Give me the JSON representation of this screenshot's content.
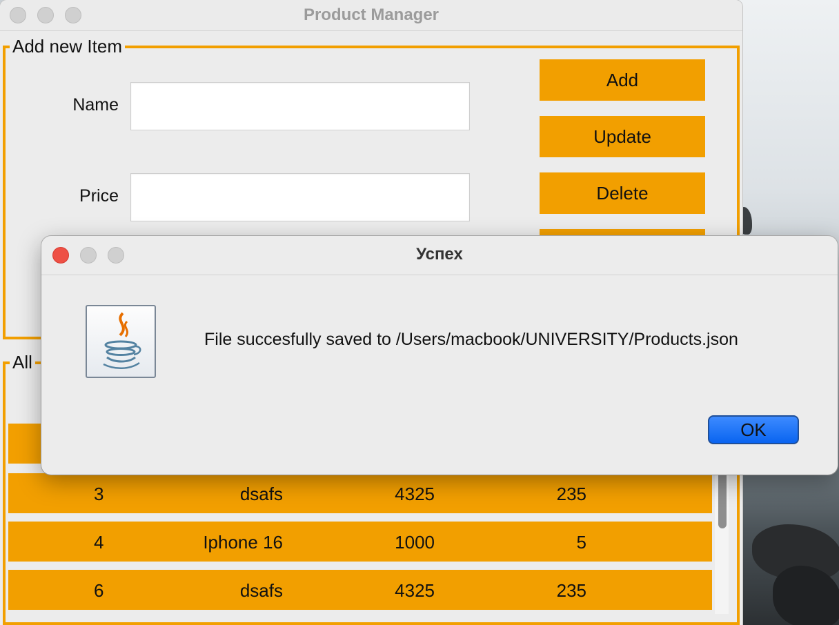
{
  "main_window": {
    "title": "Product Manager",
    "form_panel": {
      "legend": "Add new Item",
      "name_label": "Name",
      "name_value": "",
      "price_label": "Price",
      "price_value": ""
    },
    "buttons": {
      "add": "Add",
      "update": "Update",
      "delete": "Delete"
    },
    "list_panel": {
      "legend": "All",
      "rows": [
        {
          "id": "3",
          "name": "dsafs",
          "price": "4325",
          "qty": "235"
        },
        {
          "id": "4",
          "name": "Iphone 16",
          "price": "1000",
          "qty": "5"
        },
        {
          "id": "6",
          "name": "dsafs",
          "price": "4325",
          "qty": "235"
        }
      ]
    }
  },
  "dialog": {
    "title": "Успех",
    "message": "File succesfully saved to /Users/macbook/UNIVERSITY/Products.json",
    "ok_label": "OK",
    "icon": "java-icon"
  },
  "colors": {
    "accent_orange": "#f29f00",
    "ok_blue": "#0a64f0",
    "close_red": "#ee5045"
  }
}
